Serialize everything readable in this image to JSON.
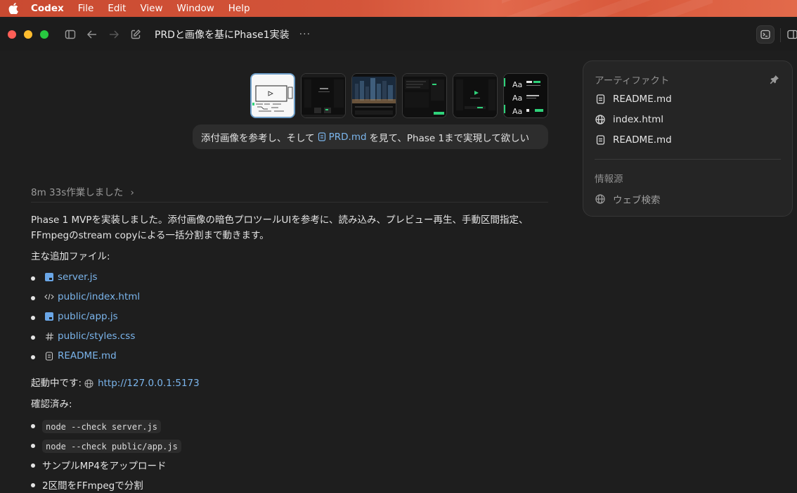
{
  "menubar": {
    "app_name": "Codex",
    "items": [
      "File",
      "Edit",
      "View",
      "Window",
      "Help"
    ]
  },
  "titlebar": {
    "thread_title": "PRDと画像を基にPhase1実装",
    "more_label": "···"
  },
  "prompt": {
    "text_before": "添付画像を参考し、そして",
    "file_link": "PRD.md",
    "text_after": "を見て、Phase 1まで実現して欲しい"
  },
  "worked": {
    "label": "8m 33s作業しました",
    "chevron": "›"
  },
  "response": {
    "intro_line1": "Phase 1 MVPを実装しました。添付画像の暗色プロツールUIを参考に、読み込み、プレビュー再生、手動区間指定、",
    "intro_line2": "FFmpegのstream copyによる一括分割まで動きます。",
    "files_heading": "主な追加ファイル:",
    "files": [
      {
        "icon": "js-file-icon",
        "name": "server.js"
      },
      {
        "icon": "html-code-icon",
        "name": "public/index.html"
      },
      {
        "icon": "js-file-icon",
        "name": "public/app.js"
      },
      {
        "icon": "hash-icon",
        "name": "public/styles.css"
      },
      {
        "icon": "document-icon",
        "name": "README.md"
      }
    ],
    "running_label": "起動中です:",
    "running_url": "http://127.0.0.1:5173",
    "verified_heading": "確認済み:",
    "verified": [
      {
        "type": "code",
        "text": "node --check server.js"
      },
      {
        "type": "code",
        "text": "node --check public/app.js"
      },
      {
        "type": "text",
        "text": "サンプルMP4をアップロード"
      },
      {
        "type": "text",
        "text": "2区間をFFmpegで分割"
      }
    ]
  },
  "artifacts_panel": {
    "heading": "アーティファクト",
    "items": [
      {
        "icon": "document-icon",
        "name": "README.md"
      },
      {
        "icon": "globe-icon",
        "name": "index.html"
      },
      {
        "icon": "document-icon",
        "name": "README.md"
      }
    ],
    "sources_heading": "情報源",
    "sources": [
      {
        "icon": "globe-icon",
        "name": "ウェブ検索"
      }
    ]
  },
  "colors": {
    "background": "#1e1e1e",
    "link": "#7bb5ec",
    "accent_green": "#2fd27a",
    "menubar": "#d4553a"
  }
}
